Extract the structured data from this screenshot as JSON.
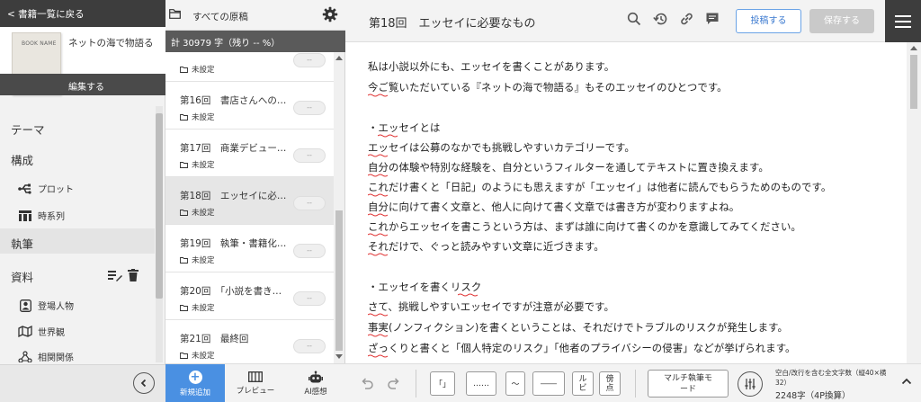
{
  "sidebar": {
    "back_label": "< 書籍一覧に戻る",
    "book_cover_text": "BOOK NAME",
    "book_title": "ネットの海で物語る",
    "edit_label": "編集する",
    "theme": "テーマ",
    "structure": "構成",
    "plot": "プロット",
    "timeline": "時系列",
    "writing": "執筆",
    "materials": "資料",
    "characters": "登場人物",
    "world": "世界観",
    "relations": "相関関係"
  },
  "episodes": {
    "header_title": "すべての原稿",
    "count_label": "計 30979 字（残り -- %）",
    "items": [
      {
        "title": "",
        "status": "未設定",
        "pill": "--"
      },
      {
        "title": "第16回　書店さんへの…",
        "status": "未設定",
        "pill": "--"
      },
      {
        "title": "第17回　商業デビュー…",
        "status": "未設定",
        "pill": "--"
      },
      {
        "title": "第18回　エッセイに必…",
        "status": "未設定",
        "pill": "--"
      },
      {
        "title": "第19回　執筆・書籍化…",
        "status": "未設定",
        "pill": "--"
      },
      {
        "title": "第20回　「小説を書き…",
        "status": "未設定",
        "pill": "--"
      },
      {
        "title": "第21回　最終回",
        "status": "未設定",
        "pill": "--"
      }
    ],
    "footer": {
      "new_label": "新規追加",
      "preview_label": "プレビュー",
      "ai_label": "AI感想"
    }
  },
  "editor": {
    "title": "第18回　エッセイに必要なもの",
    "post_label": "投稿する",
    "save_label": "保存する",
    "lines": [
      "私は小説以外にも、エッセイを書くことがあります。",
      "今ご覧いただいている『ネットの海で物語る』もそのエッセイのひとつです。",
      "",
      "・エッセイとは",
      "エッセイは公募のなかでも挑戦しやすいカテゴリーです。",
      "自分の体験や特別な経験を、自分というフィルターを通してテキストに置き換えます。",
      "これだけ書くと「日記」のようにも思えますが「エッセイ」は他者に読んでもらうためのものです。",
      "自分に向けて書く文章と、他人に向けて書く文章では書き方が変わりますよね。",
      "これからエッセイを書こうという方は、まずは誰に向けて書くのかを意識してみてください。",
      "それだけで、ぐっと読みやすい文章に近づきます。",
      "",
      "・エッセイを書くリスク",
      "さて、挑戦しやすいエッセイですが注意が必要です。",
      "事実(ノンフィクション)を書くということは、それだけでトラブルのリスクが発生します。",
      "ざっくりと書くと「個人特定のリスク」「他者のプライバシーの侵害」などが挙げられます。"
    ],
    "footer": {
      "bracket": "「」",
      "ellipsis": "……",
      "wave": "～",
      "dash": "――",
      "ruby_top": "ル",
      "ruby_bottom": "ビ",
      "bouten_top": "傍",
      "bouten_bottom": "点",
      "multi_line1": "マルチ執筆モ",
      "multi_line2": "ード",
      "count_caption": "空白/改行を含む全文字数（縦40×横32）",
      "count_value": "2248字（4P換算）"
    }
  },
  "icons": [
    "folder-icon",
    "gear-icon",
    "search-icon",
    "history-icon",
    "link-icon",
    "comment-icon",
    "menu-icon",
    "undo-icon",
    "redo-icon",
    "plus-icon",
    "book-icon",
    "robot-icon",
    "chevron-left-icon",
    "chevron-up-icon",
    "list-edit-icon",
    "trash-icon",
    "usb-icon",
    "timeline-icon",
    "person-icon",
    "map-icon",
    "relation-icon",
    "counter-icon"
  ],
  "colors": {
    "primary": "#4a90e2",
    "dark": "#3d3d3d",
    "spellcheck": "#e03030"
  }
}
